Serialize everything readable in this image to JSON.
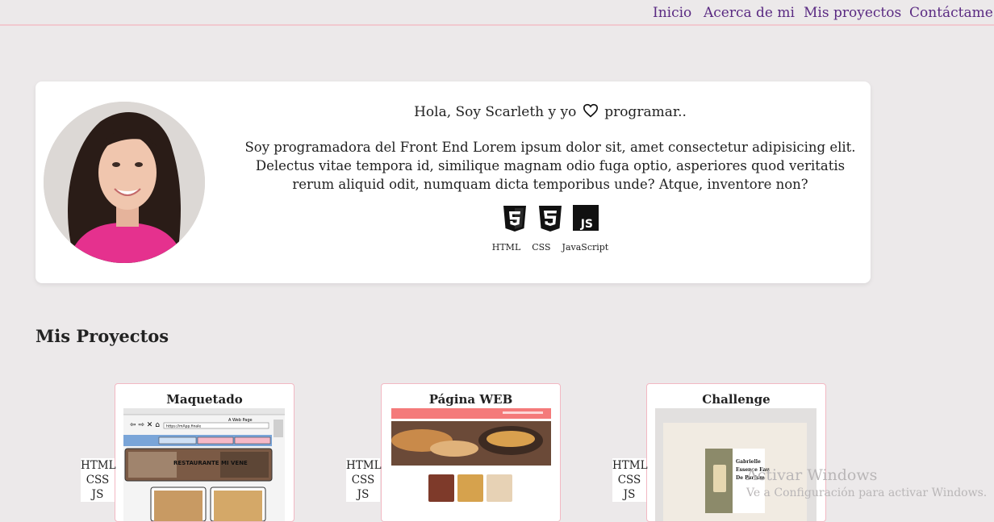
{
  "nav": {
    "items": [
      "Inicio",
      "Acerca de mi",
      "Mis proyectos",
      "Contáctame"
    ]
  },
  "hero": {
    "greeting_before": "Hola, Soy Scarleth y yo",
    "greeting_after": "programar..",
    "bio": "Soy programadora del Front End Lorem ipsum dolor sit, amet consectetur adipisicing elit. Delectus vitae tempora id, similique magnam odio fuga optio, asperiores quod veritatis rerum aliquid odit, numquam dicta temporibus unde? Atque, inventore non?",
    "skills": [
      {
        "label": "HTML",
        "icon": "html5-icon"
      },
      {
        "label": "CSS",
        "icon": "css3-icon"
      },
      {
        "label": "JavaScript",
        "icon": "javascript-icon",
        "glyph": "JS"
      }
    ]
  },
  "projects": {
    "title": "Mis Proyectos",
    "items": [
      {
        "title": "Maquetado",
        "tech": [
          "HTML",
          "CSS",
          "JS"
        ],
        "thumb": {
          "url": "https://mApp.finale",
          "window_title": "A Web Page",
          "banner": "RESTAURANTE MI VENE"
        }
      },
      {
        "title": "Página WEB",
        "tech": [
          "HTML",
          "CSS",
          "JS"
        ]
      },
      {
        "title": "Challenge",
        "tech": [
          "HTML",
          "CSS",
          "JS"
        ],
        "thumb": {
          "product_text": "Gabrielle Essence Eau De Parfum"
        }
      }
    ]
  },
  "watermark": {
    "line1": "Activar Windows",
    "line2": "Ve a Configuración para activar Windows."
  },
  "colors": {
    "background": "#ece9ea",
    "nav_link": "#5a2a82",
    "nav_border": "#f1c9cf",
    "card_border": "#f2b8c3"
  }
}
